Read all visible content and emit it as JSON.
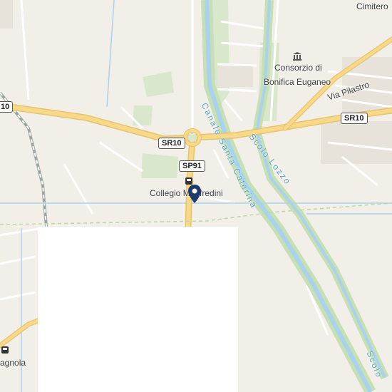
{
  "map": {
    "labels": {
      "cimitero": "Cimitero",
      "consorzio_line1": "Consorzio di",
      "consorzio_line2": "Bonifica Euganeo",
      "via_pilastro": "Via Pilastro",
      "collegio": "Collegio Manfredini",
      "agnola": "agnola"
    },
    "road_shields": {
      "sr10_left": "10",
      "sr10_center": "SR10",
      "sr10_right": "SR10",
      "sp91": "SP91"
    },
    "waterways": {
      "canale": "Canale Santa Caterina",
      "scolo_lozzo": "Scolo Lozzo",
      "scolo_right": "Scolo"
    },
    "icons": [
      "map-pin-icon",
      "bus-stop-icon",
      "museum-icon"
    ],
    "colors": {
      "background": "#f2efe9",
      "road_major": "#f6d98a",
      "road_minor": "#ffffff",
      "water": "#a9d3ec",
      "green": "#d4e6c6",
      "pin": "#1f3a6e"
    }
  }
}
